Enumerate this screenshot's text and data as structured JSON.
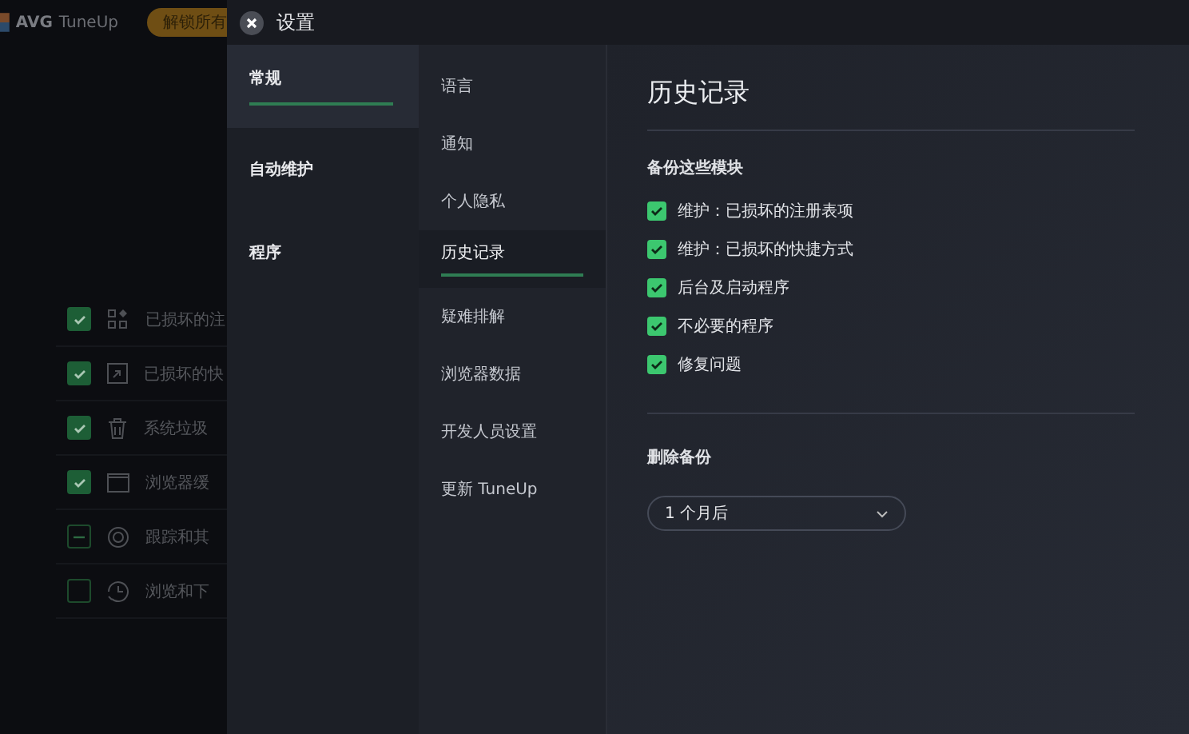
{
  "app": {
    "logo": "AVG",
    "name": "TuneUp",
    "unlock_button": "解锁所有",
    "rows": [
      {
        "label": "已损坏的注",
        "kind": "grid",
        "checked": true,
        "indeterminate": false
      },
      {
        "label": "已损坏的快",
        "kind": "shortcut",
        "checked": true,
        "indeterminate": false
      },
      {
        "label": "系统垃圾",
        "kind": "trash",
        "checked": true,
        "indeterminate": false
      },
      {
        "label": "浏览器缓",
        "kind": "window",
        "checked": true,
        "indeterminate": false
      },
      {
        "label": "跟踪和其",
        "kind": "target",
        "checked": false,
        "indeterminate": true
      },
      {
        "label": "浏览和下",
        "kind": "clock",
        "checked": false,
        "indeterminate": false
      }
    ]
  },
  "settings": {
    "title": "设置",
    "categories": [
      {
        "label": "常规",
        "selected": true
      },
      {
        "label": "自动维护",
        "selected": false
      },
      {
        "label": "程序",
        "selected": false
      }
    ],
    "pages": [
      {
        "label": "语言",
        "selected": false
      },
      {
        "label": "通知",
        "selected": false
      },
      {
        "label": "个人隐私",
        "selected": false
      },
      {
        "label": "历史记录",
        "selected": true
      },
      {
        "label": "疑难排解",
        "selected": false
      },
      {
        "label": "浏览器数据",
        "selected": false
      },
      {
        "label": "开发人员设置",
        "selected": false
      },
      {
        "label": "更新 TuneUp",
        "selected": false
      }
    ],
    "content": {
      "title": "历史记录",
      "backup_heading": "备份这些模块",
      "modules": [
        {
          "label": "维护：已损坏的注册表项",
          "checked": true
        },
        {
          "label": "维护：已损坏的快捷方式",
          "checked": true
        },
        {
          "label": "后台及启动程序",
          "checked": true
        },
        {
          "label": "不必要的程序",
          "checked": true
        },
        {
          "label": "修复问题",
          "checked": true
        }
      ],
      "delete_heading": "删除备份",
      "delete_after": "1 个月后"
    }
  }
}
